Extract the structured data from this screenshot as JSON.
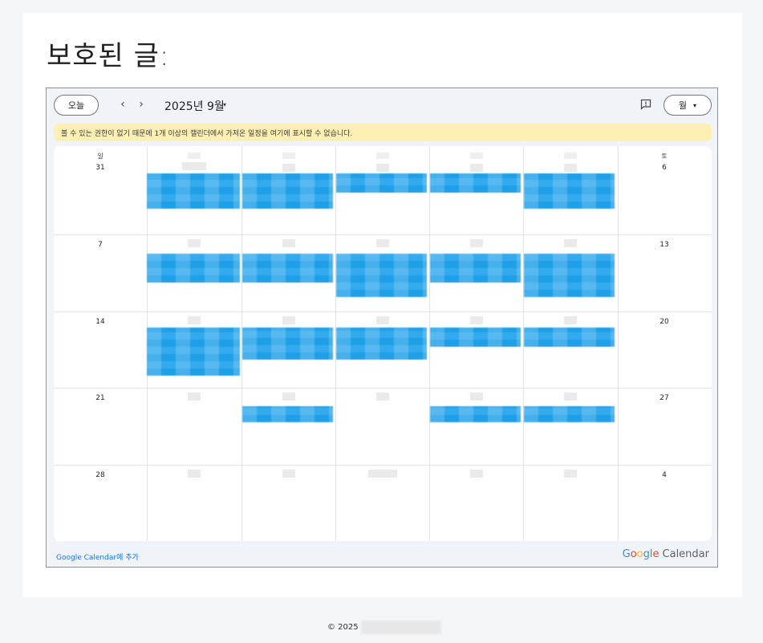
{
  "page": {
    "title": "보호된 글:"
  },
  "calendar": {
    "today_label": "오늘",
    "prev_icon": "‹",
    "next_icon": "›",
    "month_title": "2025년 9월",
    "month_caret": "▾",
    "feedback_icon": "feedback-icon",
    "view_label": "월",
    "view_caret": "▾",
    "warning": "볼 수 있는 권한이 없기 때문에 1개 이상의 캘린더에서 가져온 일정을 여기에 표시할 수 없습니다.",
    "day_headers": {
      "sun": "일",
      "sat": "토"
    },
    "week_numbers": {
      "w1": {
        "sun": "31",
        "sat": "6"
      },
      "w2": {
        "sun": "7",
        "sat": "13"
      },
      "w3": {
        "sun": "14",
        "sat": "20"
      },
      "w4": {
        "sun": "21",
        "sat": "27"
      },
      "w5": {
        "sun": "28",
        "sat": "4"
      }
    },
    "add_link": "Google Calendar에 추가",
    "brand": {
      "g": "G",
      "o1": "o",
      "o2": "o",
      "g2": "g",
      "l": "l",
      "e": "e",
      "calendar": "Calendar"
    },
    "colors": {
      "event": "#129ae6",
      "warning_bg": "#fef0b3",
      "link": "#1a73e8"
    }
  },
  "footer": {
    "copyright": "© 2025"
  }
}
